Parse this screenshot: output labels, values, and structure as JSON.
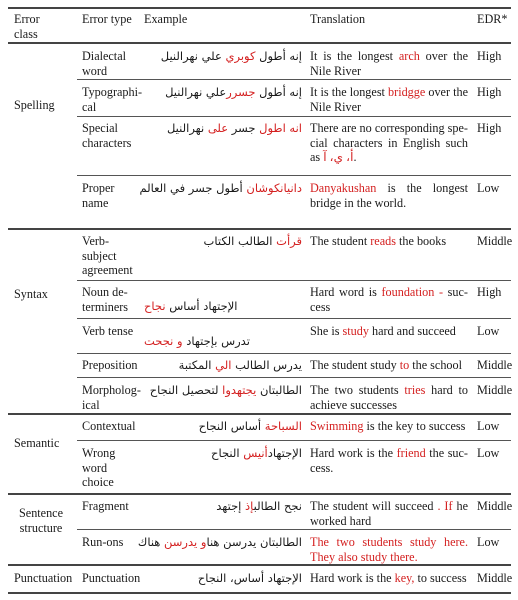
{
  "table": {
    "headers": {
      "error_class": "Error class",
      "error_class_l1": "Error",
      "error_class_l2": "class",
      "error_type": "Error type",
      "example": "Example",
      "translation": "Translation",
      "edr": "EDR*"
    },
    "groups": [
      {
        "error_class": "Spelling",
        "rows": [
          {
            "error_type_lines": [
              "Dialectal",
              "word"
            ],
            "example": {
              "before": "علي نهرالنيل",
              "highlight": "كوبري",
              "after": "إنه أطول"
            },
            "translation": {
              "pre": "It is the longest ",
              "highlight": "arch",
              "post": "  over the Nile River"
            },
            "edr": "High"
          },
          {
            "error_type_lines": [
              "Typographi-",
              "cal"
            ],
            "example": {
              "before": "علي نهرالنيل",
              "highlight": "جسرر",
              "after": "إنه أطول"
            },
            "translation": {
              "pre": "It is the longest ",
              "highlight": "bridgge",
              "post": " over the Nile River"
            },
            "edr": "High"
          },
          {
            "error_type_lines": [
              "Special",
              "characters"
            ],
            "example": {
              "highlight1": "انه اطول",
              "mid": "جسر",
              "highlight2": "على",
              "after": "نهرالنيل"
            },
            "translation": {
              "pre": "There are no corresponding spe-cial characters in English such as ",
              "highlight": "أ، ي، آ",
              "post": "."
            },
            "edr": "High"
          },
          {
            "error_type_lines": [
              "Proper",
              "name"
            ],
            "example": {
              "highlight": "دانيانكوشان",
              "after": "أطول جسر في العالم"
            },
            "translation": {
              "pre": "",
              "highlight": "Danyakushan",
              "post": " is the longest bridge in the world."
            },
            "edr": "Low"
          }
        ]
      },
      {
        "error_class": "Syntax",
        "rows": [
          {
            "error_type_lines": [
              "Verb-",
              "subject",
              "agreement"
            ],
            "example": {
              "highlight": "قرأت",
              "after": "الطالب الكتاب"
            },
            "translation": {
              "pre": "The student ",
              "highlight": "reads",
              "post": " the books"
            },
            "edr": "Middle"
          },
          {
            "error_type_lines": [
              "Noun de-",
              "terminers"
            ],
            "example": {
              "before": "الإجتهاد أساس",
              "highlight": "نجاح"
            },
            "translation": {
              "pre": "Hard word is ",
              "highlight": "foundation -",
              "post": " suc-cess"
            },
            "edr": "High"
          },
          {
            "error_type_lines": [
              "Verb tense"
            ],
            "example": {
              "before": "تدرس بإجتهاد",
              "highlight": "و نجحت"
            },
            "translation": {
              "pre": "She is ",
              "highlight": "study",
              "post": " hard and succeed"
            },
            "edr": "Low"
          },
          {
            "error_type_lines": [
              "Preposition"
            ],
            "example": {
              "before": "يدرس الطالب",
              "highlight": "الي",
              "after": "المكتبة"
            },
            "translation": {
              "pre": "The student study ",
              "highlight": "to",
              "post": " the school"
            },
            "edr": "Middle"
          },
          {
            "error_type_lines": [
              "Morpholog-",
              "ical"
            ],
            "example": {
              "before": "الطالبتان",
              "highlight": "يجتهدوا",
              "after": "لتحصيل النجاح"
            },
            "translation": {
              "pre": "The two students ",
              "highlight": "tries",
              "post": " hard to achieve successes"
            },
            "edr": "Middle"
          }
        ]
      },
      {
        "error_class": "Semantic",
        "rows": [
          {
            "error_type_lines": [
              "Contextual"
            ],
            "example": {
              "highlight": "السباحة",
              "after": "أساس النجاح"
            },
            "translation": {
              "pre": "",
              "highlight": "Swimming",
              "post": " is the key to success"
            },
            "edr": "Low"
          },
          {
            "error_type_lines": [
              "Wrong",
              "word",
              "choice"
            ],
            "example": {
              "before": "الإجتهاد",
              "highlight": "أنيس",
              "after": "النجاح"
            },
            "translation": {
              "pre": "Hard work is the ",
              "highlight": "friend",
              "post": " the suc-cess."
            },
            "edr": "Low"
          }
        ]
      },
      {
        "error_class": "Sentence structure",
        "error_class_l1": "Sentence",
        "error_class_l2": "structure",
        "rows": [
          {
            "error_type_lines": [
              "Fragment"
            ],
            "example": {
              "before": "نجح الطالب",
              "highlight": "إذ",
              "after": "إجتهد"
            },
            "translation": {
              "pre": "The student will succeed ",
              "highlight": ". If",
              "post": " he worked hard"
            },
            "edr": "Middle"
          },
          {
            "error_type_lines": [
              "Run-ons"
            ],
            "example": {
              "before": "الطالبتان يدرسن هنا",
              "highlight": "و يدرسن",
              "after": "هناك"
            },
            "translation": {
              "pre": "",
              "highlight": "The two students study here. They also study there.",
              "post": ""
            },
            "edr": "Low"
          }
        ]
      },
      {
        "error_class": "Punctuation",
        "rows": [
          {
            "error_type_lines": [
              "Punctuation"
            ],
            "example": {
              "before": "الإجتهاد أساس، النجاح"
            },
            "translation": {
              "pre": "Hard work is the ",
              "highlight": "key,",
              "post": " to success"
            },
            "edr": "Middle"
          }
        ]
      }
    ]
  },
  "colors": {
    "highlight": "#d42020",
    "text": "#1a1a1a",
    "rule": "#555555"
  }
}
